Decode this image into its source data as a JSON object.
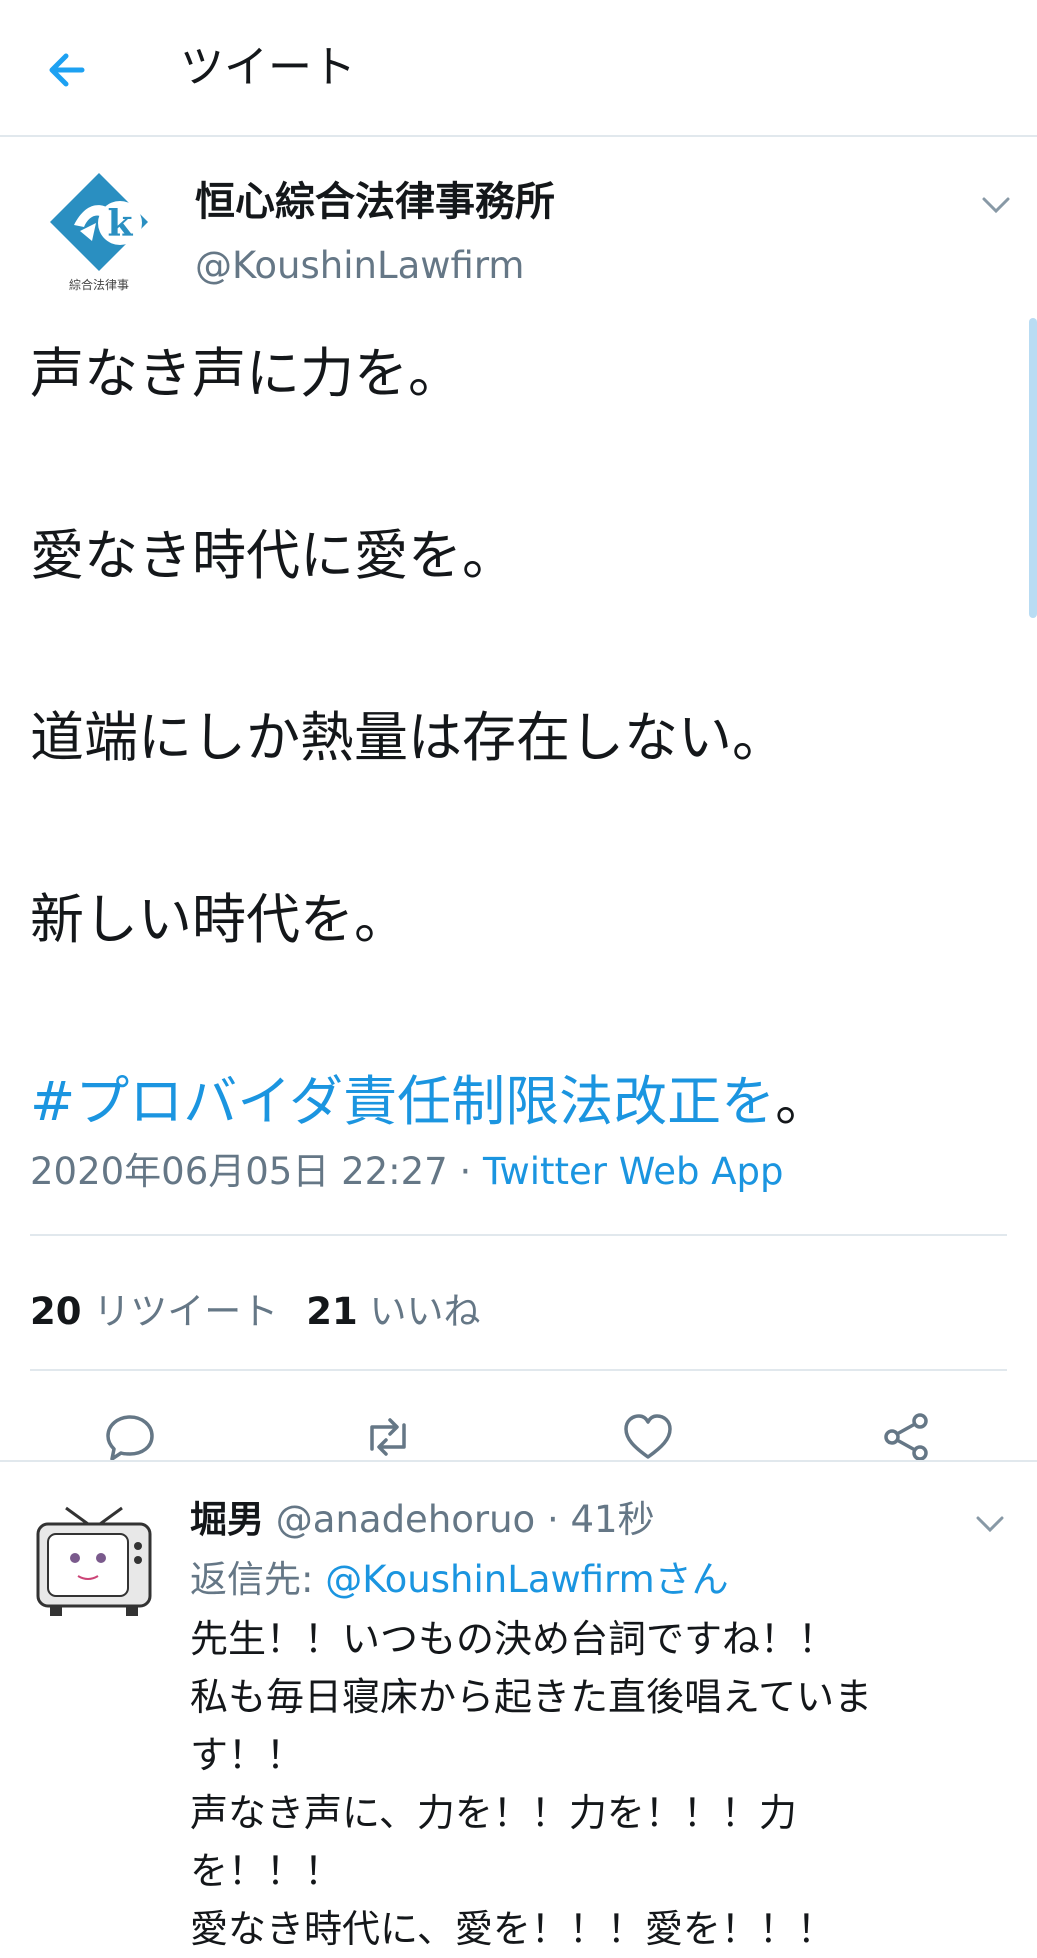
{
  "header": {
    "title": "ツイート",
    "back_icon": "arrow-left-icon",
    "accent": "#1da1f2"
  },
  "tweet": {
    "author_name": "恒心綜合法律事務所",
    "author_handle": "@KoushinLawfirm",
    "logo_text": "綜合法律事",
    "body_lines": [
      "声なき声に力を。",
      "愛なき時代に愛を。",
      "道端にしか熱量は存在しない。",
      "新しい時代を。"
    ],
    "hashtag": "#プロバイダ責任制限法改正を",
    "hashtag_suffix": "。",
    "timestamp": "2020年06月05日 22:27",
    "separator": " · ",
    "source": "Twitter Web App",
    "retweet_count": "20",
    "retweet_label": "リツイート",
    "like_count": "21",
    "like_label": "いいね"
  },
  "reply": {
    "name": "堀男",
    "handle": "@anadehoruo",
    "time": "41秒",
    "reply_to_label": "返信先: ",
    "reply_to_mention": "@KoushinLawfirmさん",
    "lines": [
      "先生！！いつもの決め台詞ですね！！",
      "私も毎日寝床から起きた直後唱えていま",
      "す！！",
      "声なき声に、力を！！力を！！！力",
      "を！！！",
      "愛なき時代に、愛を！！！愛を！！！"
    ]
  },
  "colors": {
    "link": "#1b95e0",
    "secondary_text": "#657786",
    "divider": "#e1e8ed",
    "logo": "#2a8fc1"
  }
}
